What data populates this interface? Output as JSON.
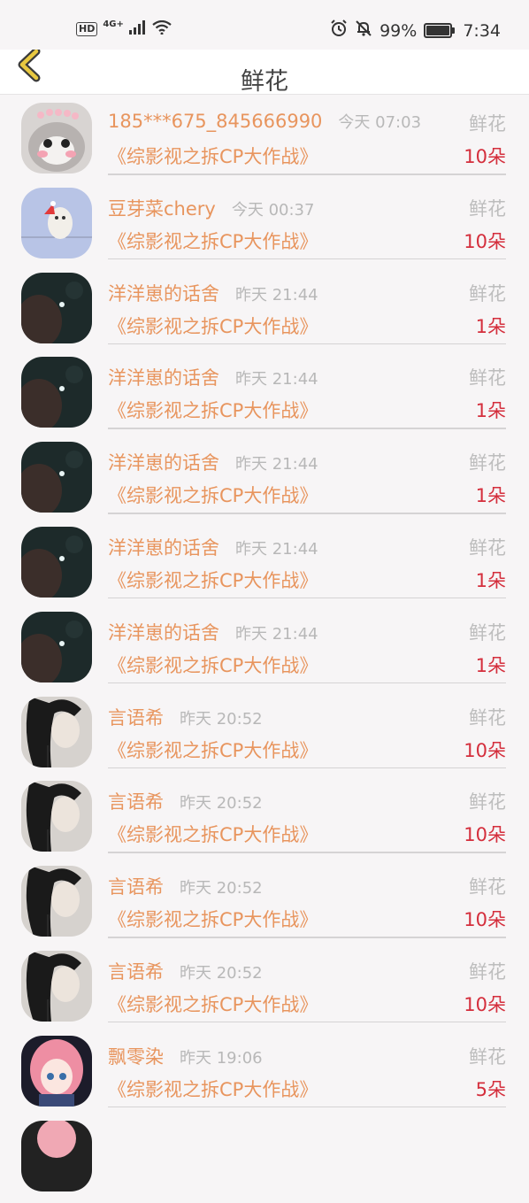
{
  "status_bar": {
    "hd": "HD",
    "network": "4G+",
    "battery": "99%",
    "time": "7:34",
    "icons": [
      "signal-icon",
      "wifi-icon",
      "alarm-icon",
      "mute-bell-icon",
      "battery-icon"
    ]
  },
  "header": {
    "title": "鲜花",
    "back_icon": "chevron-left-icon"
  },
  "records": [
    {
      "name": "185***675_845666990",
      "time": "今天 07:03",
      "gift": "鲜花",
      "room": "《综影视之拆CP大作战》",
      "count": "10朵",
      "avatar": "cat"
    },
    {
      "name": "豆芽菜chery",
      "time": "今天 00:37",
      "gift": "鲜花",
      "room": "《综影视之拆CP大作战》",
      "count": "10朵",
      "avatar": "dog"
    },
    {
      "name": "洋洋崽的话舍",
      "time": "昨天 21:44",
      "gift": "鲜花",
      "room": "《综影视之拆CP大作战》",
      "count": "1朵",
      "avatar": "night"
    },
    {
      "name": "洋洋崽的话舍",
      "time": "昨天 21:44",
      "gift": "鲜花",
      "room": "《综影视之拆CP大作战》",
      "count": "1朵",
      "avatar": "night"
    },
    {
      "name": "洋洋崽的话舍",
      "time": "昨天 21:44",
      "gift": "鲜花",
      "room": "《综影视之拆CP大作战》",
      "count": "1朵",
      "avatar": "night"
    },
    {
      "name": "洋洋崽的话舍",
      "time": "昨天 21:44",
      "gift": "鲜花",
      "room": "《综影视之拆CP大作战》",
      "count": "1朵",
      "avatar": "night"
    },
    {
      "name": "洋洋崽的话舍",
      "time": "昨天 21:44",
      "gift": "鲜花",
      "room": "《综影视之拆CP大作战》",
      "count": "1朵",
      "avatar": "night"
    },
    {
      "name": "言语希",
      "time": "昨天 20:52",
      "gift": "鲜花",
      "room": "《综影视之拆CP大作战》",
      "count": "10朵",
      "avatar": "girl"
    },
    {
      "name": "言语希",
      "time": "昨天 20:52",
      "gift": "鲜花",
      "room": "《综影视之拆CP大作战》",
      "count": "10朵",
      "avatar": "girl"
    },
    {
      "name": "言语希",
      "time": "昨天 20:52",
      "gift": "鲜花",
      "room": "《综影视之拆CP大作战》",
      "count": "10朵",
      "avatar": "girl"
    },
    {
      "name": "言语希",
      "time": "昨天 20:52",
      "gift": "鲜花",
      "room": "《综影视之拆CP大作战》",
      "count": "10朵",
      "avatar": "girl"
    },
    {
      "name": "飘零染",
      "time": "昨天 19:06",
      "gift": "鲜花",
      "room": "《综影视之拆CP大作战》",
      "count": "5朵",
      "avatar": "anime"
    }
  ],
  "colors": {
    "name": "#e8955e",
    "count": "#d42e3c",
    "muted": "#bdbdbd",
    "back_icon": "#e8c840"
  }
}
